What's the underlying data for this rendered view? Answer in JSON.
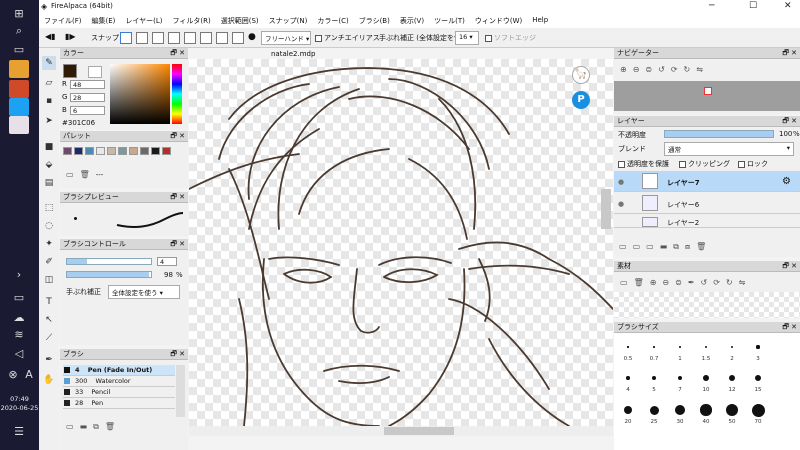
{
  "window": {
    "title": "FireAlpaca (64bit)"
  },
  "menu": [
    "ファイル(F)",
    "編集(E)",
    "レイヤー(L)",
    "フィルタ(R)",
    "選択範囲(S)",
    "スナップ(N)",
    "カラー(C)",
    "ブラシ(B)",
    "表示(V)",
    "ツール(T)",
    "ウィンドウ(W)",
    "Help"
  ],
  "toolbar": {
    "snap_label": "スナップ",
    "freehand": "フリーハンド",
    "antialias": "アンチエイリアス",
    "stabilizer_label": "手ぶれ補正 (全体設定を使う)",
    "stabilizer_value": "16",
    "soft_edge": "ソフトエッジ"
  },
  "color_panel": {
    "title": "カラー",
    "r_label": "R",
    "r": "48",
    "g_label": "G",
    "g": "28",
    "b_label": "B",
    "b": "6",
    "hex": "#301C06",
    "fg": "#301C06"
  },
  "palette_panel": {
    "title": "パレット",
    "dashes": "---",
    "swatches": [
      "#6b4a6b",
      "#1a2a6b",
      "#4a8ab5",
      "#e8e8e8",
      "#c8b8a8",
      "#7a9aa0",
      "#c8a890",
      "#706868",
      "#1a1a1a",
      "#b03030"
    ]
  },
  "brush_preview": {
    "title": "ブラシプレビュー"
  },
  "brush_control": {
    "title": "ブラシコントロール",
    "size": "4",
    "opacity": "98",
    "opacity_unit": "%",
    "stabilizer": "手ぶれ補正",
    "stabilizer_option": "全体設定を使う"
  },
  "brush_panel": {
    "title": "ブラシ",
    "items": [
      {
        "size": "4",
        "name": "Pen (Fade In/Out)",
        "color": "#111111"
      },
      {
        "size": "300",
        "name": "Watercolor",
        "color": "#5aa0d0"
      },
      {
        "size": "33",
        "name": "Pencil",
        "color": "#222222"
      },
      {
        "size": "28",
        "name": "Pen",
        "color": "#222222"
      }
    ]
  },
  "canvas": {
    "tab": "natale2.mdp"
  },
  "navigator": {
    "title": "ナビゲーター"
  },
  "layer_panel": {
    "title": "レイヤー",
    "opacity_label": "不透明度",
    "opacity": "100",
    "opacity_unit": "%",
    "blend_label": "ブレンド",
    "blend": "通常",
    "protect": "透明度を保護",
    "clipping": "クリッピング",
    "lock": "ロック",
    "layers": [
      "レイヤー7",
      "レイヤー6",
      "レイヤー2"
    ]
  },
  "material_panel": {
    "title": "素材"
  },
  "brush_size_panel": {
    "title": "ブラシサイズ",
    "sizes": [
      [
        "0.5",
        "0.7",
        "1",
        "1.5",
        "2",
        "3"
      ],
      [
        "4",
        "5",
        "7",
        "10",
        "12",
        "15"
      ],
      [
        "20",
        "25",
        "30",
        "40",
        "50",
        "70"
      ]
    ]
  },
  "taskbar": {
    "time": "07:49",
    "date": "2020-06-25"
  }
}
